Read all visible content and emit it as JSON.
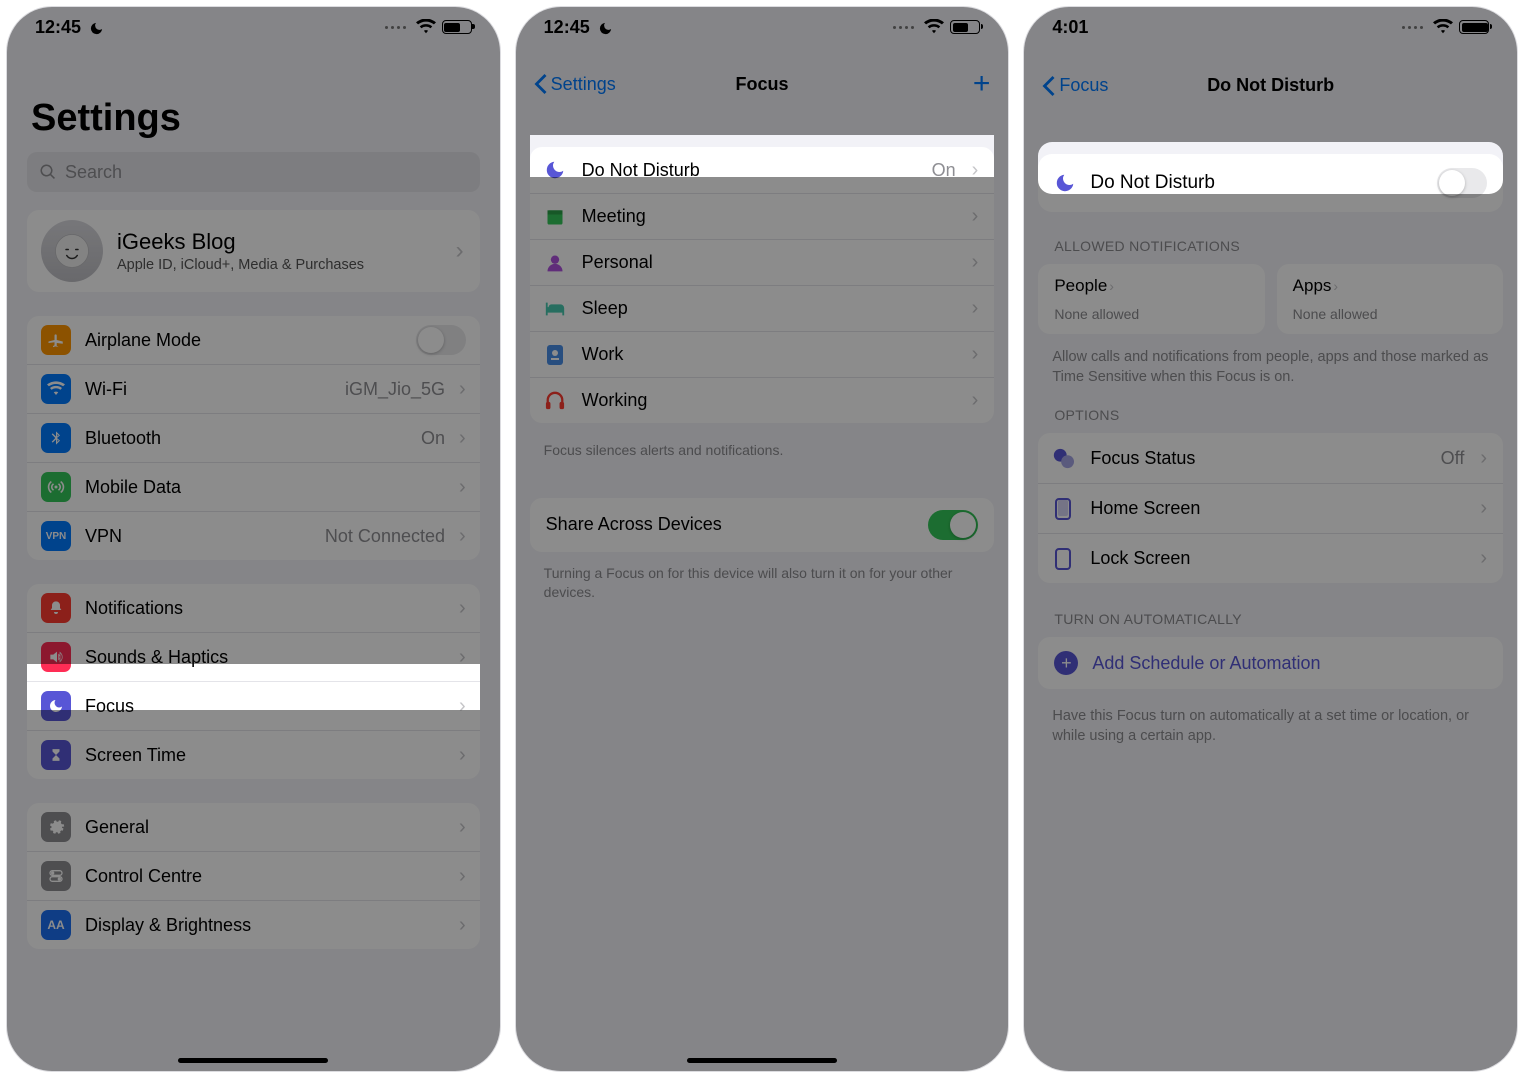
{
  "screens": {
    "settings": {
      "status": {
        "time": "12:45",
        "battery_pct": 55
      },
      "title": "Settings",
      "search_placeholder": "Search",
      "profile": {
        "name": "iGeeks Blog",
        "sub": "Apple ID, iCloud+, Media & Purchases"
      },
      "group1": {
        "airplane": "Airplane Mode",
        "wifi": "Wi-Fi",
        "wifi_value": "iGM_Jio_5G",
        "bluetooth": "Bluetooth",
        "bluetooth_value": "On",
        "mobile": "Mobile Data",
        "vpn": "VPN",
        "vpn_value": "Not Connected"
      },
      "group2": {
        "notifications": "Notifications",
        "sounds": "Sounds & Haptics",
        "focus": "Focus",
        "screentime": "Screen Time"
      },
      "group3": {
        "general": "General",
        "control": "Control Centre",
        "display": "Display & Brightness"
      }
    },
    "focus": {
      "status": {
        "time": "12:45",
        "battery_pct": 55
      },
      "back": "Settings",
      "title": "Focus",
      "items": {
        "dnd": "Do Not Disturb",
        "dnd_value": "On",
        "meeting": "Meeting",
        "personal": "Personal",
        "sleep": "Sleep",
        "work": "Work",
        "working": "Working"
      },
      "footer1": "Focus silences alerts and notifications.",
      "share_label": "Share Across Devices",
      "footer2": "Turning a Focus on for this device will also turn it on for your other devices."
    },
    "dnd": {
      "status": {
        "time": "4:01",
        "battery_pct": 95
      },
      "back": "Focus",
      "title": "Do Not Disturb",
      "main": "Do Not Disturb",
      "sec_allowed": "Allowed Notifications",
      "tiles": {
        "people": "People",
        "people_sub": "None allowed",
        "apps": "Apps",
        "apps_sub": "None allowed"
      },
      "paragraph1": "Allow calls and notifications from people, apps and those marked as Time Sensitive when this Focus is on.",
      "sec_options": "Options",
      "options": {
        "status": "Focus Status",
        "status_value": "Off",
        "home": "Home Screen",
        "lock": "Lock Screen"
      },
      "sec_auto": "Turn On Automatically",
      "add_schedule": "Add Schedule or Automation",
      "paragraph2": "Have this Focus turn on automatically at a set time or location, or while using a certain app."
    }
  }
}
